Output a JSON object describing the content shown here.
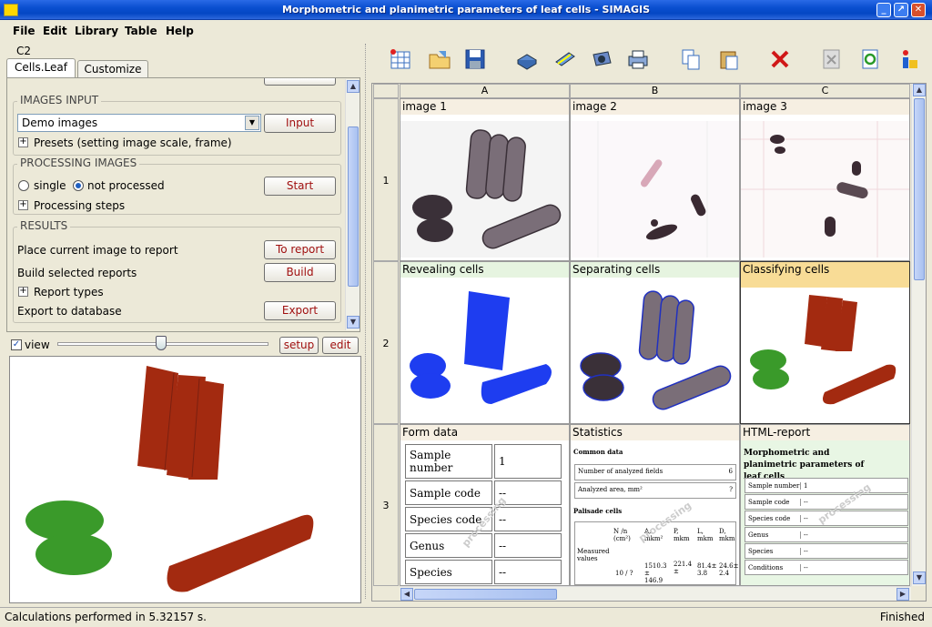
{
  "window": {
    "title": "Morphometric and planimetric parameters of leaf cells - SIMAGIS"
  },
  "menu": [
    "File",
    "Edit",
    "Library",
    "Table",
    "Help"
  ],
  "left": {
    "cell_ref": "C2",
    "tabs": [
      "Cells.Leaf",
      "Customize"
    ],
    "images_input": {
      "label": "IMAGES INPUT",
      "select_value": "Demo images",
      "button": "Input",
      "presets": "Presets (setting image scale, frame)"
    },
    "processing": {
      "label": "PROCESSING IMAGES",
      "radio_single": "single",
      "radio_not_processed": "not processed",
      "button": "Start",
      "steps": "Processing steps"
    },
    "results": {
      "label": "RESULTS",
      "place_text": "Place current image to report",
      "place_button": "To report",
      "build_text": "Build selected reports",
      "build_button": "Build",
      "report_types": "Report types",
      "export_text": "Export to database",
      "export_button": "Export"
    },
    "view": {
      "check_label": "view",
      "setup": "setup",
      "edit": "edit"
    }
  },
  "grid": {
    "columns": [
      "A",
      "B",
      "C"
    ],
    "rows": [
      "1",
      "2",
      "3"
    ],
    "cells": {
      "r1": [
        "image 1",
        "image 2",
        "image 3"
      ],
      "r2": [
        "Revealing cells",
        "Separating cells",
        "Classifying cells"
      ],
      "r3": [
        "Form data",
        "Statistics",
        "HTML-report"
      ]
    },
    "form_data": [
      [
        "Sample number",
        "1"
      ],
      [
        "Sample code",
        "--"
      ],
      [
        "Species code",
        "--"
      ],
      [
        "Genus",
        "--"
      ],
      [
        "Species",
        "--"
      ]
    ],
    "statistics": {
      "common": "Common data",
      "rows": [
        [
          "Number of analyzed fields",
          "6"
        ],
        [
          "Analyzed area, mm²",
          "?"
        ]
      ],
      "palisade": "Palisade cells",
      "header": [
        "Measured values",
        "N /n (cm²)",
        "A, mkm²",
        "P, mkm",
        "L, mkm",
        "D, mkm"
      ],
      "values": [
        "10 / ?",
        "1510.3 ± 146.9",
        "221.4 ±",
        "81.4± 3.8",
        "24.6± 2.4"
      ]
    },
    "html_report": {
      "title": "Morphometric and planimetric parameters of leaf cells",
      "rows": [
        [
          "Sample number",
          "1"
        ],
        [
          "Sample code",
          "--"
        ],
        [
          "Species code",
          "--"
        ],
        [
          "Genus",
          "--"
        ],
        [
          "Species",
          "--"
        ],
        [
          "Conditions",
          "--"
        ]
      ]
    },
    "watermark": "processing"
  },
  "status": {
    "left": "Calculations performed in 5.32157 s.",
    "right": "Finished"
  },
  "colors": {
    "red": "#a32a10",
    "green": "#3a9a2a",
    "blue": "#1e3df0"
  }
}
